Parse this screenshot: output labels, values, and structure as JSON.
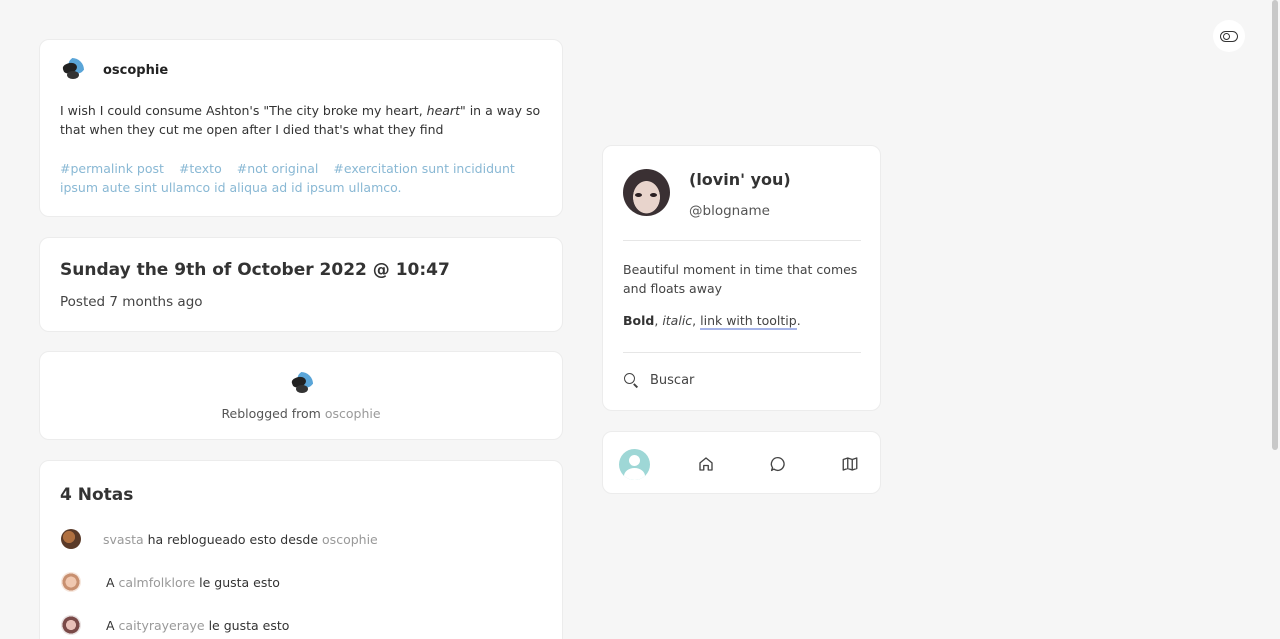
{
  "theme_toggle": {
    "icon": "toggle-icon"
  },
  "post": {
    "username": "oscophie",
    "body_before": "I wish I could consume Ashton's \"The city broke my heart, ",
    "body_em": "heart",
    "body_after": "\" in a way so that when they cut me open after I died that's what they find",
    "tags": [
      "#permalink post",
      "#texto",
      "#not original",
      "#exercitation sunt incididunt ipsum aute sint ullamco id aliqua ad id ipsum ullamco."
    ],
    "tag_color": "#89b8d4"
  },
  "date_card": {
    "title": "Sunday the 9th of October 2022 @ 10:47",
    "subtitle": "Posted 7 months ago"
  },
  "reblog": {
    "prefix": "Reblogged from ",
    "source": "oscophie"
  },
  "notes": {
    "title": "4 Notas",
    "items": [
      {
        "pre": "",
        "user": "svasta",
        "post": " ha reblogueado esto desde ",
        "source": "oscophie"
      },
      {
        "pre": "A ",
        "user": "calmfolklore",
        "post": " le gusta esto",
        "source": ""
      },
      {
        "pre": "A ",
        "user": "caityrayeraye",
        "post": " le gusta esto",
        "source": ""
      }
    ]
  },
  "profile": {
    "name": "(lovin' you)",
    "handle": "@blogname",
    "description": "Beautiful moment in time that comes and floats away",
    "fmt_bold": "Bold",
    "fmt_sep1": ", ",
    "fmt_italic": "italic",
    "fmt_sep2": ", ",
    "fmt_link": "link with tooltip",
    "fmt_end": ".",
    "search_label": "Buscar"
  },
  "nav": {
    "items": [
      {
        "name": "avatar",
        "icon": "user-avatar-icon"
      },
      {
        "name": "home",
        "icon": "home-icon"
      },
      {
        "name": "messages",
        "icon": "chat-bubble-icon"
      },
      {
        "name": "archive",
        "icon": "map-icon"
      }
    ],
    "avatar_color": "#9ed7d6"
  }
}
